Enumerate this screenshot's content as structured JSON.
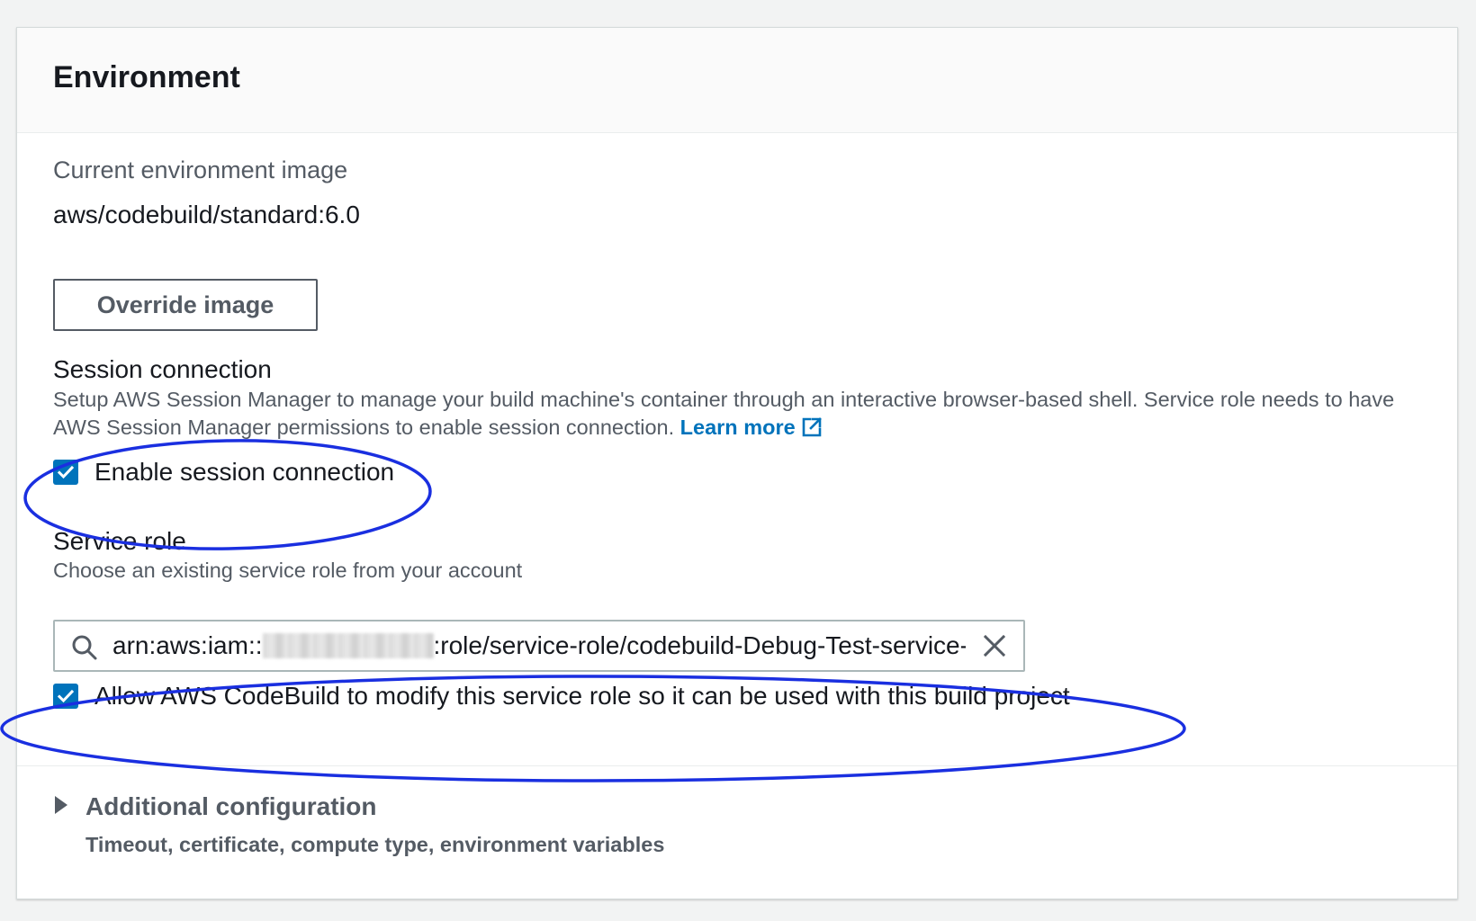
{
  "panel": {
    "title": "Environment"
  },
  "environment_image": {
    "label": "Current environment image",
    "value": "aws/codebuild/standard:6.0",
    "override_button": "Override image"
  },
  "session_connection": {
    "label": "Session connection",
    "description": "Setup AWS Session Manager to manage your build machine's container through an interactive browser-based shell. Service role needs to have AWS Session Manager permissions to enable session connection.",
    "learn_more": "Learn more",
    "checkbox_label": "Enable session connection",
    "checked": true
  },
  "service_role": {
    "label": "Service role",
    "description": "Choose an existing service role from your account",
    "value_prefix": "arn:aws:iam::",
    "value_suffix": ":role/service-role/codebuild-Debug-Test-service-r",
    "allow_modify_label": "Allow AWS CodeBuild to modify this service role so it can be used with this build project",
    "allow_modify_checked": true
  },
  "additional_configuration": {
    "title": "Additional configuration",
    "description": "Timeout, certificate, compute type, environment variables"
  },
  "colors": {
    "accent": "#0073bb",
    "annotation": "#1a2fe0",
    "text": "#16191f",
    "muted_text": "#545b64"
  }
}
